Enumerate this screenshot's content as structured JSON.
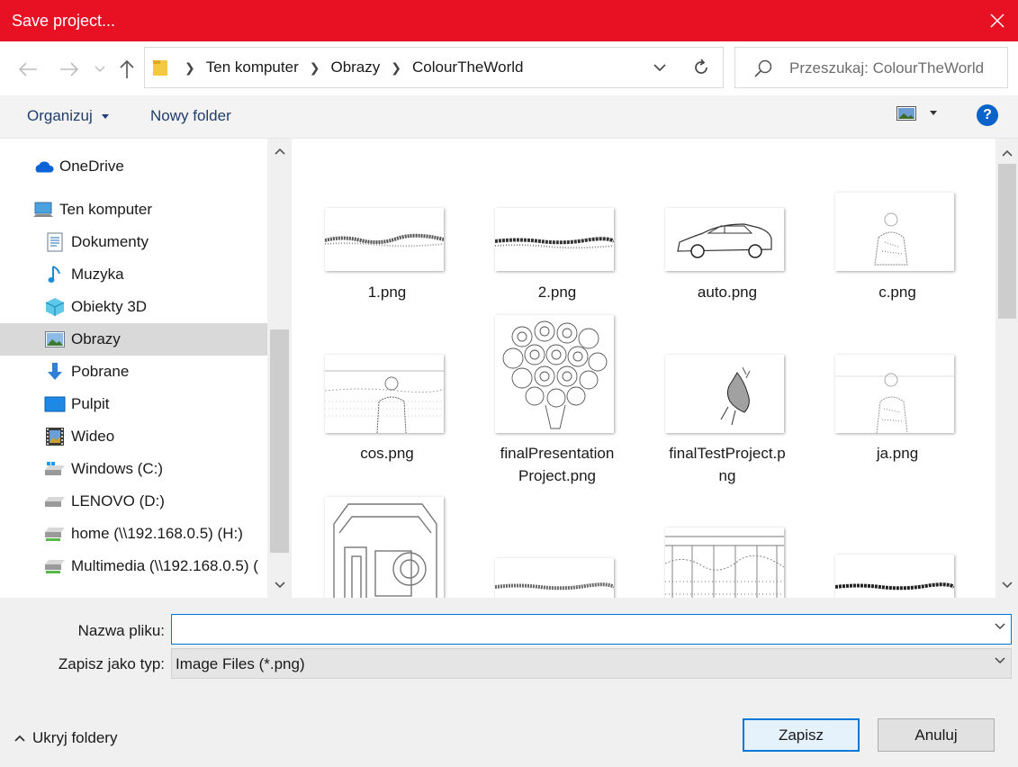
{
  "window": {
    "title": "Save project..."
  },
  "address": {
    "crumbs": [
      "Ten komputer",
      "Obrazy",
      "ColourTheWorld"
    ],
    "search_placeholder": "Przeszukaj: ColourTheWorld"
  },
  "toolbar": {
    "organize_label": "Organizuj",
    "new_folder_label": "Nowy folder",
    "help_label": "?"
  },
  "sidebar": {
    "items": [
      {
        "label": "OneDrive",
        "icon": "onedrive-cloud-icon"
      },
      {
        "label": "Ten komputer",
        "icon": "computer-icon"
      },
      {
        "label": "Dokumenty",
        "icon": "documents-icon"
      },
      {
        "label": "Muzyka",
        "icon": "music-icon"
      },
      {
        "label": "Obiekty 3D",
        "icon": "3d-objects-icon"
      },
      {
        "label": "Obrazy",
        "icon": "pictures-icon",
        "selected": true
      },
      {
        "label": "Pobrane",
        "icon": "downloads-icon"
      },
      {
        "label": "Pulpit",
        "icon": "desktop-icon"
      },
      {
        "label": "Wideo",
        "icon": "video-icon"
      },
      {
        "label": "Windows (C:)",
        "icon": "windows-drive-icon"
      },
      {
        "label": "LENOVO (D:)",
        "icon": "drive-icon"
      },
      {
        "label": "home (\\\\192.168.0.5) (H:)",
        "icon": "network-drive-icon"
      },
      {
        "label": "Multimedia (\\\\192.168.0.5) (",
        "icon": "network-drive-icon"
      }
    ]
  },
  "files": [
    {
      "name": "1.png"
    },
    {
      "name": "2.png"
    },
    {
      "name": "auto.png"
    },
    {
      "name": "c.png"
    },
    {
      "name": "cos.png"
    },
    {
      "name_line1": "finalPresentation",
      "name_line2": "Project.png"
    },
    {
      "name_line1": "finalTestProject.p",
      "name_line2": "ng"
    },
    {
      "name": "ja.png"
    }
  ],
  "form": {
    "filename_label": "Nazwa pliku:",
    "filename_value": "",
    "filetype_label": "Zapisz jako typ:",
    "filetype_value": "Image Files (*.png)"
  },
  "footer": {
    "hide_folders_label": "Ukryj foldery",
    "save_label": "Zapisz",
    "cancel_label": "Anuluj"
  },
  "colors": {
    "titlebar": "#e81123",
    "accent": "#0078d7",
    "selected": "#d9d9d9"
  }
}
